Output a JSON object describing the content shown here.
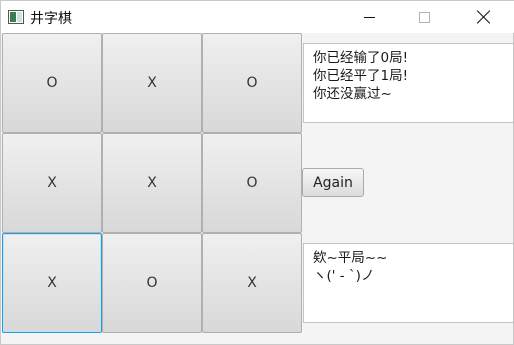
{
  "window": {
    "title": "井字棋",
    "icon": "app-window-icon"
  },
  "board": {
    "cells": [
      "O",
      "X",
      "O",
      "X",
      "X",
      "O",
      "X",
      "O",
      "X"
    ],
    "focused_index": 6
  },
  "stats_text": {
    "lines": [
      "你已经输了0局!",
      "你已经平了1局!",
      "你还没赢过~"
    ]
  },
  "again_button": {
    "label": "Again"
  },
  "message_text": {
    "lines": [
      "欸~平局~~",
      "ヽ(' - `)ノ"
    ]
  },
  "colors": {
    "focus_border": "#2a9ad6",
    "window_bg": "#f4f4f4"
  }
}
